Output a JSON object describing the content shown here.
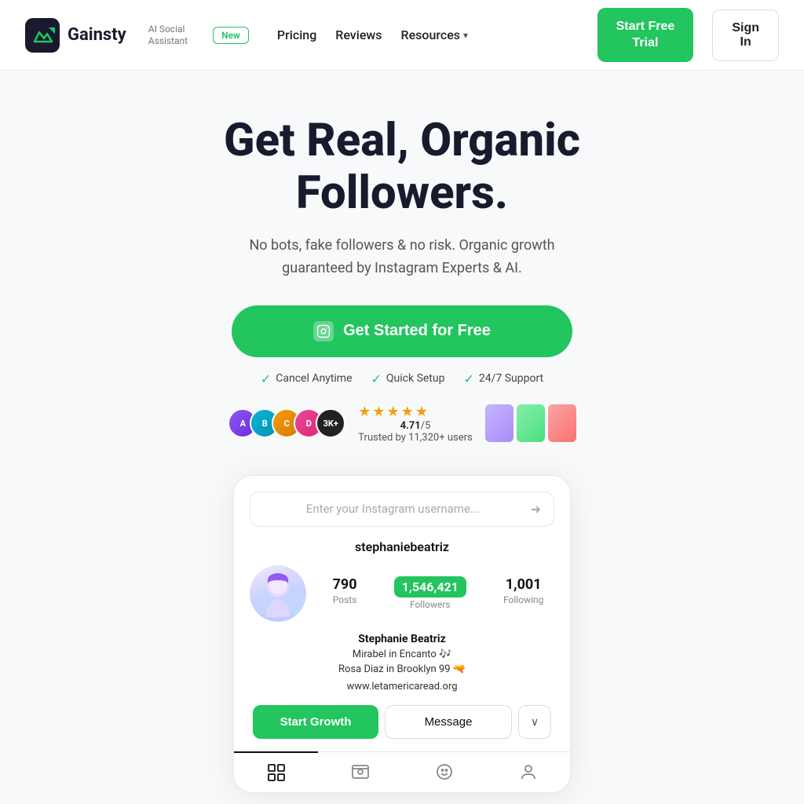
{
  "brand": {
    "logo_text": "Gainsty",
    "ai_label": "AI Social\nAssistant"
  },
  "nav": {
    "new_badge": "New",
    "pricing": "Pricing",
    "reviews": "Reviews",
    "resources": "Resources",
    "start_trial": "Start Free\nTrial",
    "sign_in": "Sign\nIn"
  },
  "hero": {
    "title": "Get Real, Organic Followers.",
    "subtitle": "No bots, fake followers & no risk. Organic growth guaranteed by Instagram Experts & AI.",
    "cta": "Get Started for Free",
    "trust": {
      "cancel": "Cancel Anytime",
      "setup": "Quick Setup",
      "support": "24/7 Support"
    },
    "rating": {
      "score": "4.71",
      "max": "5",
      "trust_text": "Trusted by 11,320+ users"
    },
    "avatar_count": "3K+"
  },
  "profile_card": {
    "search_placeholder": "Enter your Instagram username...",
    "username": "stephaniebeatriz",
    "posts_count": "790",
    "posts_label": "Posts",
    "followers_count": "1,546,421",
    "followers_label": "Followers",
    "following_count": "1,001",
    "following_label": "Following",
    "bio_name": "Stephanie Beatriz",
    "bio_line1": "Mirabel in Encanto 🎶",
    "bio_line2": "Rosa Diaz in Brooklyn 99 🔫",
    "bio_link": "www.letamericaread.org",
    "btn_growth": "Start Growth",
    "btn_message": "Message",
    "btn_dropdown": "∨"
  },
  "colors": {
    "green": "#22c55e",
    "dark": "#1a1a2e",
    "star": "#f59e0b"
  }
}
